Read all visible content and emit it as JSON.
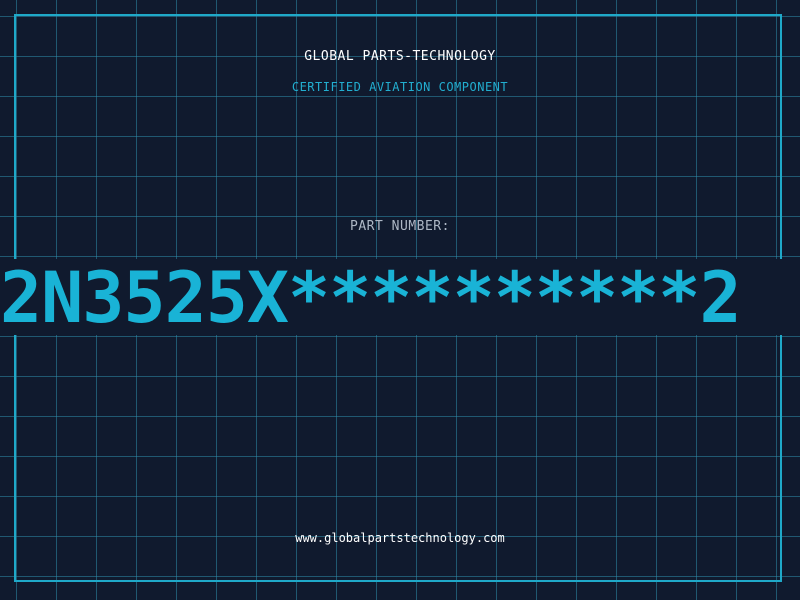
{
  "header": {
    "company": "GLOBAL PARTS-TECHNOLOGY",
    "subtitle": "CERTIFIED AVIATION COMPONENT"
  },
  "part": {
    "label": "PART NUMBER:",
    "number": "2N3525X**********2"
  },
  "footer": {
    "website": "www.globalpartstechnology.com"
  },
  "colors": {
    "background": "#101a2e",
    "accent": "#19b3d6",
    "grid": "#2e8aa8",
    "text": "#ffffff"
  }
}
